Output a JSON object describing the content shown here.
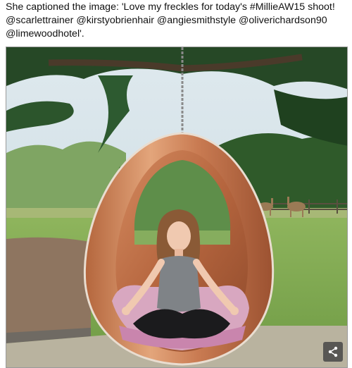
{
  "caption": {
    "line1": "She captioned the image: 'Love my freckles for today's #MillieAW15 shoot!",
    "line2": "@scarlettrainer @kirstyobrienhair @angiesmithstyle @oliverichardson90",
    "line3": "@limewoodhotel'."
  },
  "photo": {
    "share_icon": "share-icon"
  }
}
